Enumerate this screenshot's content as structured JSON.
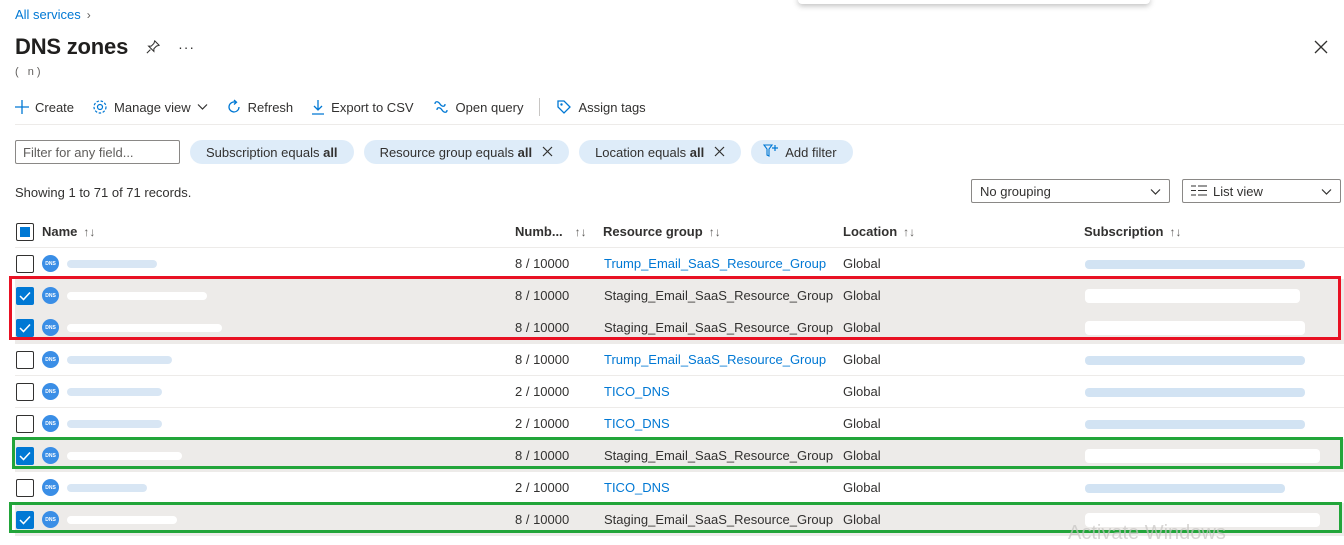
{
  "breadcrumb": {
    "label": "All services",
    "chevron": "›"
  },
  "title": {
    "text": "DNS zones",
    "more": "···"
  },
  "subtitle": "(                              n)",
  "toolbar": {
    "create": "Create",
    "manage_view": "Manage view",
    "refresh": "Refresh",
    "export_csv": "Export to CSV",
    "open_query": "Open query",
    "assign_tags": "Assign tags"
  },
  "filter": {
    "placeholder": "Filter for any field...",
    "pills": [
      {
        "prefix": "Subscription equals",
        "value": "all"
      },
      {
        "prefix": "Resource group equals",
        "value": "all"
      },
      {
        "prefix": "Location equals",
        "value": "all"
      }
    ],
    "add_filter": "Add filter"
  },
  "records_text": "Showing 1 to 71 of 71 records.",
  "grouping": {
    "value": "No grouping"
  },
  "view": {
    "value": "List view"
  },
  "columns": {
    "name": "Name",
    "number": "Numb...",
    "resource_group": "Resource group",
    "location": "Location",
    "subscription": "Subscription",
    "sort_icon": "↑↓"
  },
  "rows": [
    {
      "checked": false,
      "number": "8 / 10000",
      "resource_group": "Trump_Email_SaaS_Resource_Group",
      "location": "Global"
    },
    {
      "checked": true,
      "number": "8 / 10000",
      "resource_group": "Staging_Email_SaaS_Resource_Group",
      "location": "Global"
    },
    {
      "checked": true,
      "number": "8 / 10000",
      "resource_group": "Staging_Email_SaaS_Resource_Group",
      "location": "Global"
    },
    {
      "checked": false,
      "number": "8 / 10000",
      "resource_group": "Trump_Email_SaaS_Resource_Group",
      "location": "Global"
    },
    {
      "checked": false,
      "number": "2 / 10000",
      "resource_group": "TICO_DNS",
      "location": "Global"
    },
    {
      "checked": false,
      "number": "2 / 10000",
      "resource_group": "TICO_DNS",
      "location": "Global"
    },
    {
      "checked": true,
      "number": "8 / 10000",
      "resource_group": "Staging_Email_SaaS_Resource_Group",
      "location": "Global"
    },
    {
      "checked": false,
      "number": "2 / 10000",
      "resource_group": "TICO_DNS",
      "location": "Global"
    },
    {
      "checked": true,
      "number": "8 / 10000",
      "resource_group": "Staging_Email_SaaS_Resource_Group",
      "location": "Global"
    }
  ],
  "dns_icon_text": "DNS",
  "watermark": "Activate Windows",
  "colors": {
    "accent": "#0078d4",
    "highlight_red": "#e81123",
    "highlight_green": "#22a53a",
    "pill_bg": "#deecf9"
  }
}
